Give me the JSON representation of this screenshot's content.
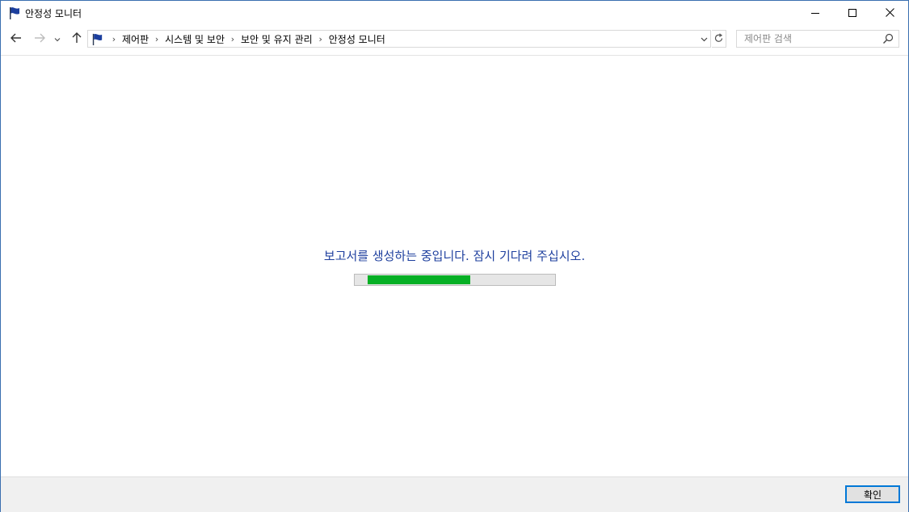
{
  "window": {
    "title": "안정성 모니터",
    "app_icon": "blue-flag-icon",
    "controls": {
      "minimize": "minimize-icon",
      "maximize": "maximize-icon",
      "close": "close-icon"
    }
  },
  "nav": {
    "back_icon": "arrow-left-icon",
    "forward_icon": "arrow-right-icon",
    "recent_icon": "chevron-down-icon",
    "up_icon": "arrow-up-icon"
  },
  "address": {
    "breadcrumbs": [
      "제어판",
      "시스템 및 보안",
      "보안 및 유지 관리",
      "안정성 모니터"
    ],
    "separator": "›"
  },
  "search": {
    "placeholder": "제어판 검색",
    "value": ""
  },
  "main": {
    "status_message": "보고서를 생성하는 중입니다. 잠시 기다려 주십시오.",
    "progress": {
      "style": "marquee",
      "segment_start_percent": 6.5,
      "segment_width_percent": 51
    }
  },
  "footer": {
    "ok_label": "확인"
  },
  "colors": {
    "accent": "#0078d7",
    "status_text": "#1e3f9e",
    "progress_fill": "#06b025",
    "progress_track": "#e6e6e6",
    "footer_bg": "#f0f0f0",
    "flag_blue": "#1c3f9e"
  }
}
